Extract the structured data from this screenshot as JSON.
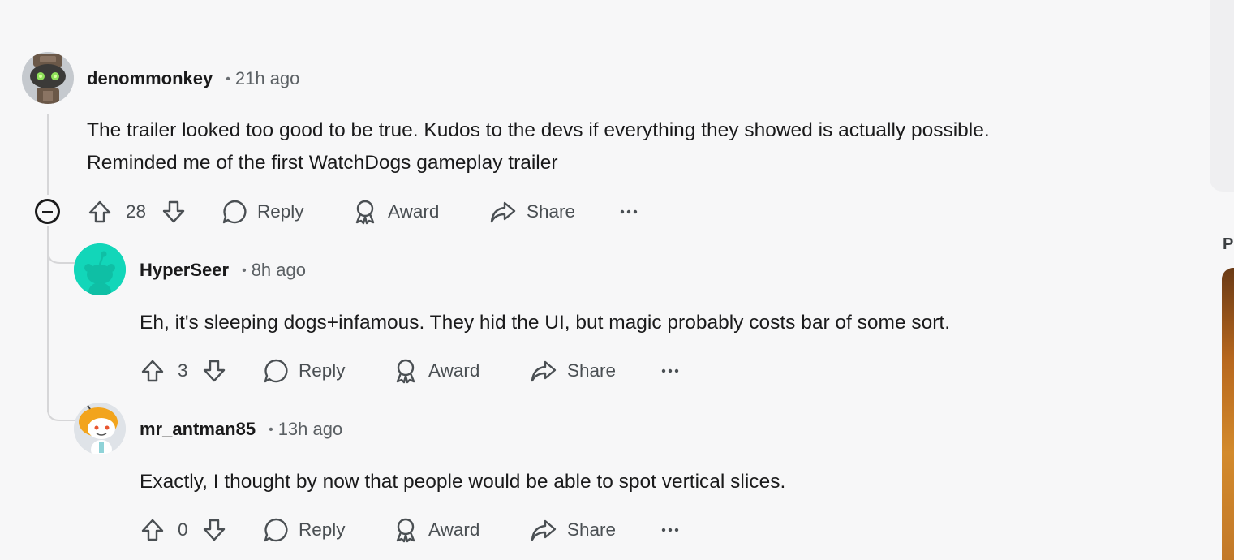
{
  "comments": [
    {
      "author": "denommonkey",
      "time": "21h ago",
      "body_lines": [
        "The trailer looked too good to be true. Kudos to the devs if everything they showed is actually possible.",
        "Reminded me of the first WatchDogs gameplay trailer"
      ],
      "score": "28",
      "avatar_icon": "robot-avatar-icon"
    },
    {
      "author": "HyperSeer",
      "time": "8h ago",
      "body_lines": [
        "Eh, it's sleeping dogs+infamous. They hid the UI, but magic probably costs bar of some sort."
      ],
      "score": "3",
      "avatar_icon": "snoo-avatar-icon"
    },
    {
      "author": "mr_antman85",
      "time": "13h ago",
      "body_lines": [
        "Exactly, I thought by now that people would be able to spot vertical slices."
      ],
      "score": "0",
      "avatar_icon": "snoo-avatar-icon"
    }
  ],
  "actions": {
    "reply": "Reply",
    "award": "Award",
    "share": "Share",
    "more": "···"
  },
  "separator": "•",
  "sidebar": {
    "partial_letter": "P"
  },
  "colors": {
    "background": "#f7f7f8",
    "text": "#1a1a1b",
    "muted": "#545a5e",
    "hyperseer_avatar_bg": "#12d6b9",
    "thread_line": "#d6d6d8"
  }
}
